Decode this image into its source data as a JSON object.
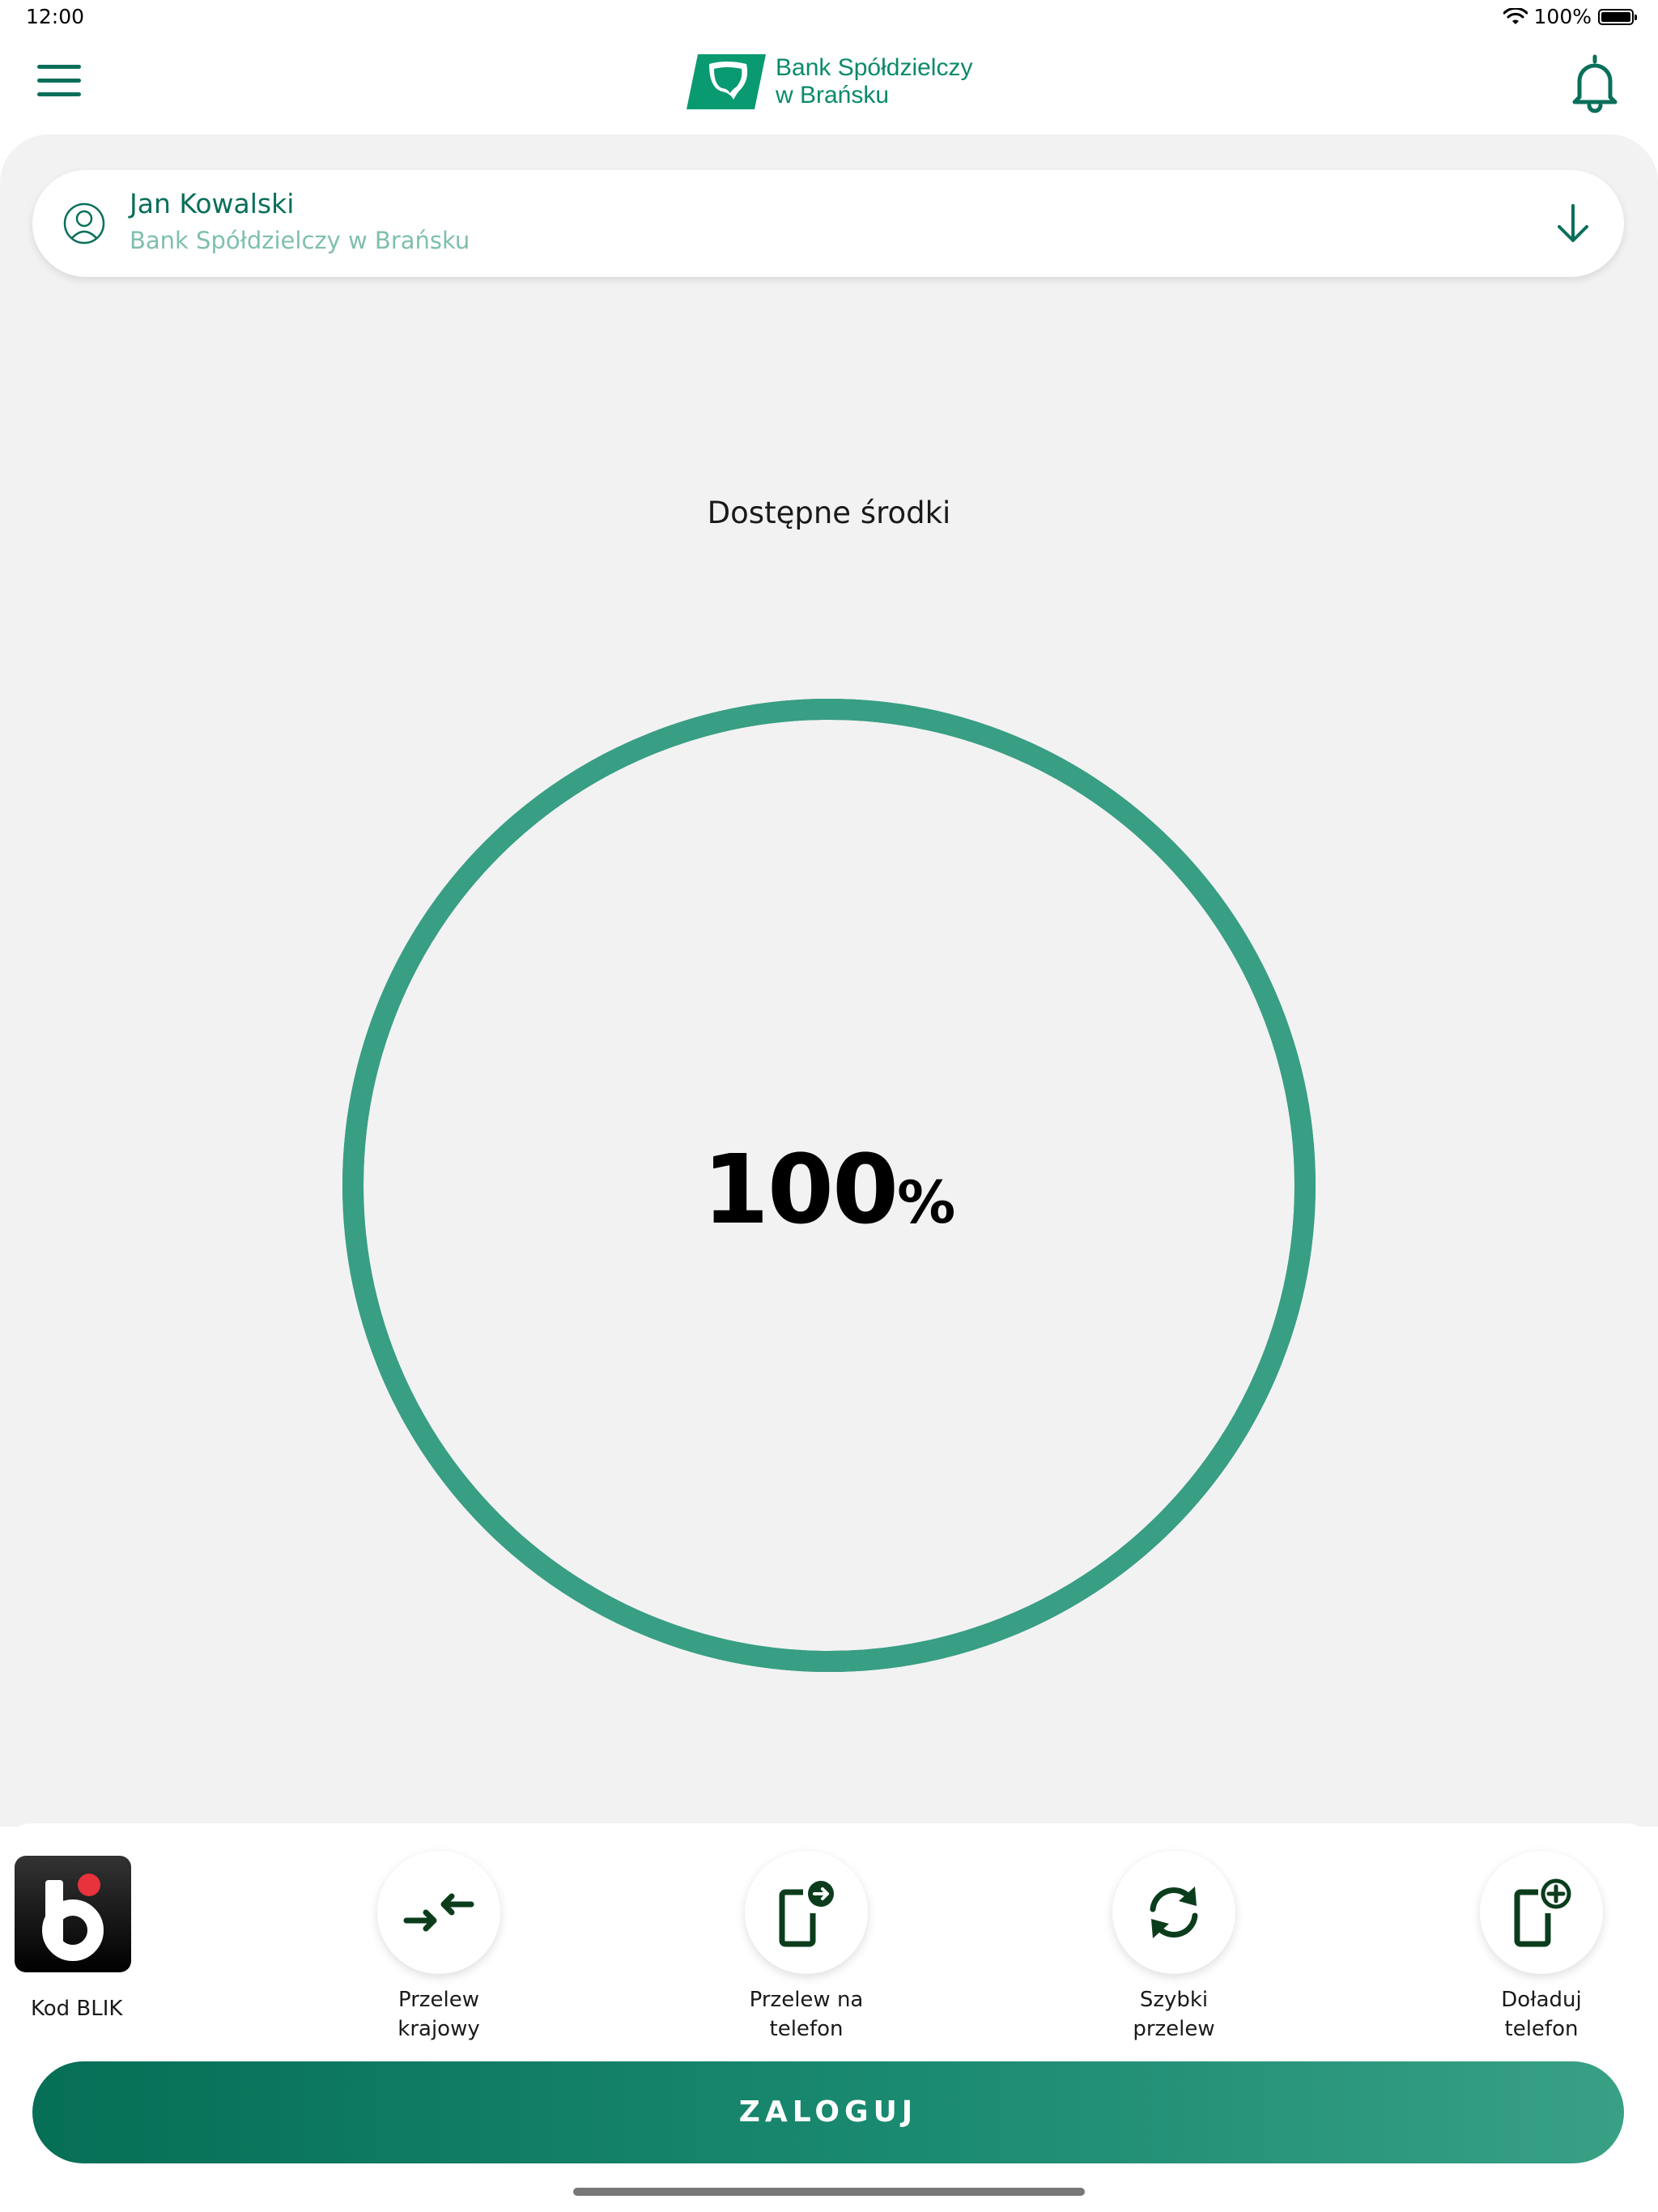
{
  "status_bar": {
    "time": "12:00",
    "battery": "100%"
  },
  "header": {
    "logo_line1": "Bank Spółdzielczy",
    "logo_line2": "w Brańsku",
    "icons": {
      "menu": "hamburger-icon",
      "notifications": "bell-icon"
    }
  },
  "account": {
    "name": "Jan Kowalski",
    "bank": "Bank Spółdzielczy w Brańsku",
    "icons": {
      "avatar": "user-icon",
      "expand": "arrow-down-icon"
    }
  },
  "funds": {
    "label": "Dostępne środki",
    "percent_value": "100",
    "percent_sign": "%",
    "ring_fill": 1.0
  },
  "quick_actions": [
    {
      "label": "Kod BLIK",
      "icon": "blik-icon"
    },
    {
      "label": "Przelew\nkrajowy",
      "icon": "transfer-arrows-icon"
    },
    {
      "label": "Przelew na\ntelefon",
      "icon": "phone-transfer-icon"
    },
    {
      "label": "Szybki\nprzelew",
      "icon": "refresh-icon"
    },
    {
      "label": "Doładuj\ntelefon",
      "icon": "phone-topup-icon"
    }
  ],
  "login": {
    "label": "ZALOGUJ"
  },
  "colors": {
    "brand": "#0a6f5a",
    "ring": "#389e84",
    "accent_light": "#7fbfae",
    "blik_dot": "#e8323c"
  }
}
